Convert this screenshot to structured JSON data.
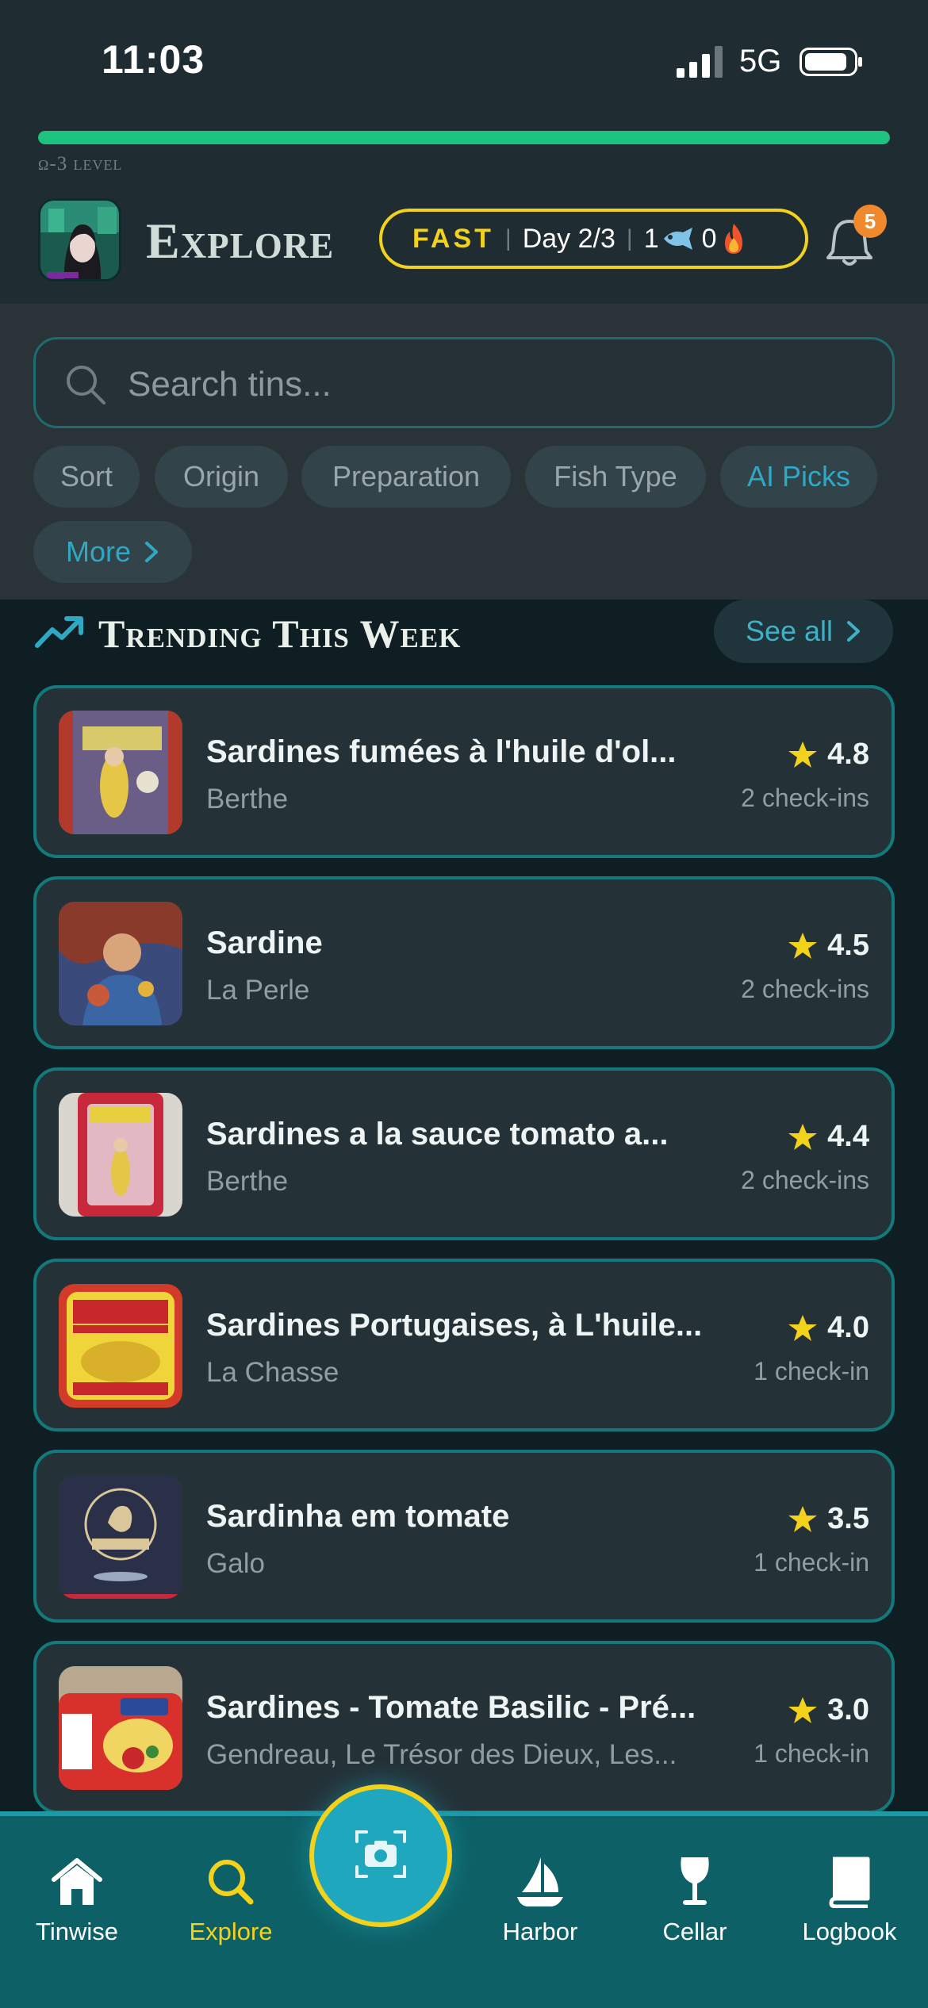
{
  "status_bar": {
    "time": "11:03",
    "network": "5G"
  },
  "header": {
    "level_label": "ω-3 level",
    "level_progress": 1.0,
    "title": "Explore",
    "streak": {
      "mode": "FAST",
      "day": "Day 2/3",
      "fish_count": "1",
      "flame_count": "0"
    },
    "notifications": "5"
  },
  "search": {
    "placeholder": "Search tins..."
  },
  "filters": {
    "chips": [
      "Sort",
      "Origin",
      "Preparation",
      "Fish Type",
      "AI Picks"
    ],
    "more_label": "More"
  },
  "trending": {
    "title": "Trending This Week",
    "see_all": "See all",
    "items": [
      {
        "name": "Sardines fumées à l'huile d'ol...",
        "brand": "Berthe",
        "rating": "4.8",
        "checkins": "2 check-ins"
      },
      {
        "name": "Sardine",
        "brand": "La Perle",
        "rating": "4.5",
        "checkins": "2 check-ins"
      },
      {
        "name": "Sardines a la sauce tomato a...",
        "brand": "Berthe",
        "rating": "4.4",
        "checkins": "2 check-ins"
      },
      {
        "name": "Sardines Portugaises, à L'huile...",
        "brand": "La Chasse",
        "rating": "4.0",
        "checkins": "1 check-in"
      },
      {
        "name": "Sardinha em tomate",
        "brand": "Galo",
        "rating": "3.5",
        "checkins": "1 check-in"
      },
      {
        "name": "Sardines - Tomate Basilic - Pré...",
        "brand": "Gendreau, Le Trésor des Dieux, Les...",
        "rating": "3.0",
        "checkins": "1 check-in"
      }
    ]
  },
  "nav": {
    "items": [
      "Tinwise",
      "Explore",
      "Harbor",
      "Cellar",
      "Logbook"
    ],
    "active": "Explore"
  },
  "colors": {
    "accent_yellow": "#f3d21c",
    "accent_teal": "#1fa8bd",
    "progress_green": "#1cc27d",
    "badge_orange": "#f0892c"
  }
}
